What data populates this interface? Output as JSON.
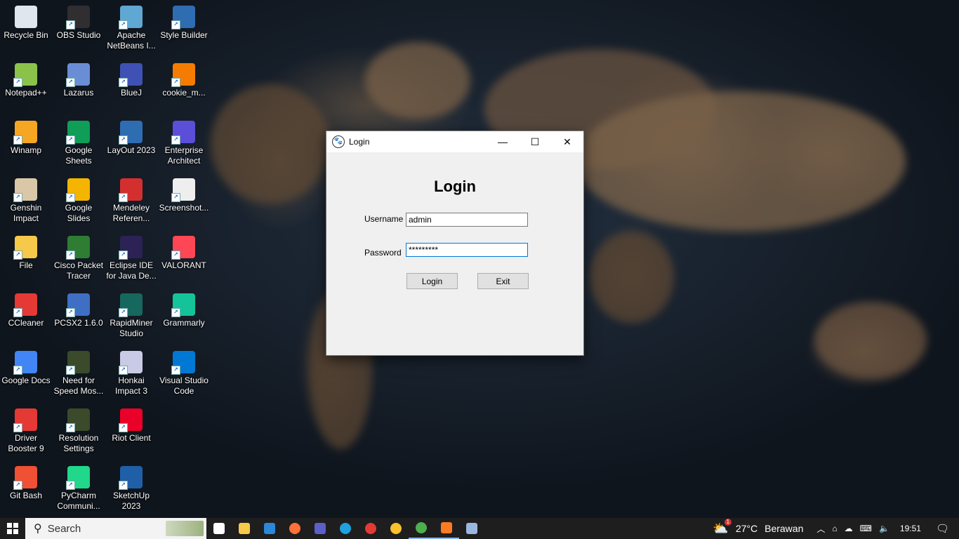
{
  "desktop": {
    "icons": [
      {
        "label": "Recycle Bin",
        "icon": "recycle-bin-icon",
        "color": "#dfe6ee"
      },
      {
        "label": "Notepad++",
        "icon": "notepadpp-icon",
        "color": "#8bc34a"
      },
      {
        "label": "Winamp",
        "icon": "winamp-icon",
        "color": "#f5a623"
      },
      {
        "label": "Genshin Impact",
        "icon": "genshin-icon",
        "color": "#d9c7a8"
      },
      {
        "label": "File",
        "icon": "folder-icon",
        "color": "#f6c94a"
      },
      {
        "label": "CCleaner",
        "icon": "ccleaner-icon",
        "color": "#e53935"
      },
      {
        "label": "Google Docs",
        "icon": "google-docs-icon",
        "color": "#4285f4"
      },
      {
        "label": "Driver Booster 9",
        "icon": "driver-booster-icon",
        "color": "#e53935"
      },
      {
        "label": "Git Bash",
        "icon": "git-bash-icon",
        "color": "#f05033"
      },
      {
        "label": "OBS Studio",
        "icon": "obs-icon",
        "color": "#302e31"
      },
      {
        "label": "Lazarus",
        "icon": "lazarus-icon",
        "color": "#6a8ed6"
      },
      {
        "label": "Google Sheets",
        "icon": "google-sheets-icon",
        "color": "#0f9d58"
      },
      {
        "label": "Google Slides",
        "icon": "google-slides-icon",
        "color": "#f4b400"
      },
      {
        "label": "Cisco Packet Tracer",
        "icon": "packet-tracer-icon",
        "color": "#2e7d32"
      },
      {
        "label": "PCSX2 1.6.0",
        "icon": "pcsx2-icon",
        "color": "#3f6fc4"
      },
      {
        "label": "Need for Speed Mos...",
        "icon": "nfs-icon",
        "color": "#3a4a2a"
      },
      {
        "label": "Resolution Settings",
        "icon": "resolution-icon",
        "color": "#3a4a2a"
      },
      {
        "label": "PyCharm Communi...",
        "icon": "pycharm-icon",
        "color": "#21d789"
      },
      {
        "label": "Apache NetBeans I...",
        "icon": "netbeans-icon",
        "color": "#5fa8d3"
      },
      {
        "label": "BlueJ",
        "icon": "bluej-icon",
        "color": "#3f51b5"
      },
      {
        "label": "LayOut 2023",
        "icon": "layout-icon",
        "color": "#2f6db3"
      },
      {
        "label": "Mendeley Referen...",
        "icon": "mendeley-icon",
        "color": "#d32f2f"
      },
      {
        "label": "Eclipse IDE for Java De...",
        "icon": "eclipse-icon",
        "color": "#2c2255"
      },
      {
        "label": "RapidMiner Studio",
        "icon": "rapidminer-icon",
        "color": "#16685e"
      },
      {
        "label": "Honkai Impact 3",
        "icon": "honkai-icon",
        "color": "#c9cbe6"
      },
      {
        "label": "Riot Client",
        "icon": "riot-icon",
        "color": "#eb0029"
      },
      {
        "label": "SketchUp 2023",
        "icon": "sketchup-icon",
        "color": "#1f5fa8"
      },
      {
        "label": "Style Builder",
        "icon": "style-builder-icon",
        "color": "#2f6db3"
      },
      {
        "label": "cookie_m...",
        "icon": "cookie-icon",
        "color": "#f57c00"
      },
      {
        "label": "Enterprise Architect",
        "icon": "enterprise-architect-icon",
        "color": "#5b4ed8"
      },
      {
        "label": "Screenshot...",
        "icon": "screenshot-file-icon",
        "color": "#eeeeee"
      },
      {
        "label": "VALORANT",
        "icon": "valorant-icon",
        "color": "#ff4655"
      },
      {
        "label": "Grammarly",
        "icon": "grammarly-icon",
        "color": "#15c39a"
      },
      {
        "label": "Visual Studio Code",
        "icon": "vscode-icon",
        "color": "#0078d4"
      }
    ]
  },
  "login_window": {
    "title": "Login",
    "heading": "Login",
    "username_label": "Username",
    "username_value": "admin",
    "password_label": "Password",
    "password_value": "*********",
    "login_button": "Login",
    "exit_button": "Exit",
    "minimize_glyph": "—",
    "maximize_glyph": "☐",
    "close_glyph": "✕"
  },
  "taskbar": {
    "search_placeholder": "Search",
    "pinned_apps": [
      {
        "icon": "task-view-icon",
        "color": "#ffffff"
      },
      {
        "icon": "file-explorer-icon",
        "color": "#f6c94a"
      },
      {
        "icon": "microsoft-store-icon",
        "color": "#2b88d8"
      },
      {
        "icon": "firefox-icon",
        "color": "#ff7139"
      },
      {
        "icon": "media-app-icon",
        "color": "#5b5fc7"
      },
      {
        "icon": "edge-icon",
        "color": "#1fa1e0"
      },
      {
        "icon": "davinci-icon",
        "color": "#e53935"
      },
      {
        "icon": "chrome-icon",
        "color": "#fbc02d"
      },
      {
        "icon": "chrome-profile-icon",
        "color": "#4caf50"
      },
      {
        "icon": "xampp-icon",
        "color": "#fb7a24"
      },
      {
        "icon": "app-gear-icon",
        "color": "#9ab7e0"
      }
    ],
    "weather_temp": "27°C",
    "weather_desc": "Berawan",
    "weather_badge": "1",
    "clock": "19:51"
  }
}
